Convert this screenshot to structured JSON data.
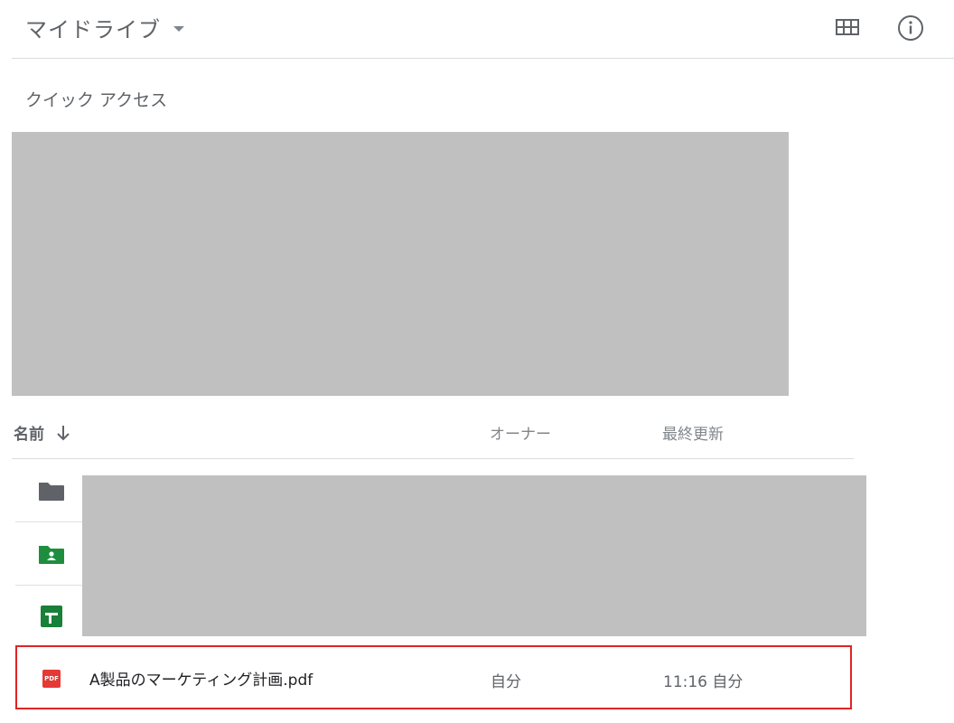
{
  "header": {
    "title": "マイドライブ",
    "grid_icon": "grid-view-icon",
    "info_icon": "info-icon"
  },
  "quick_access": {
    "label": "クイック アクセス"
  },
  "list": {
    "columns": {
      "name": "名前",
      "owner": "オーナー",
      "modified": "最終更新"
    },
    "sort_icon": "arrow-down-icon",
    "rows": [
      {
        "icon": "folder-icon",
        "color": "#5f6368"
      },
      {
        "icon": "shared-folder-icon",
        "color": "#1e8e3e"
      },
      {
        "icon": "google-sheets-icon",
        "color": "#188038"
      },
      {
        "icon": "pdf-icon",
        "icon_text": "PDF",
        "name": "A製品のマーケティング計画.pdf",
        "owner": "自分",
        "modified": "11:16 自分",
        "highlighted": true
      }
    ]
  },
  "colors": {
    "highlight_border": "#e02424",
    "redacted": "#c0c0c0",
    "pdf_red": "#e53935"
  }
}
